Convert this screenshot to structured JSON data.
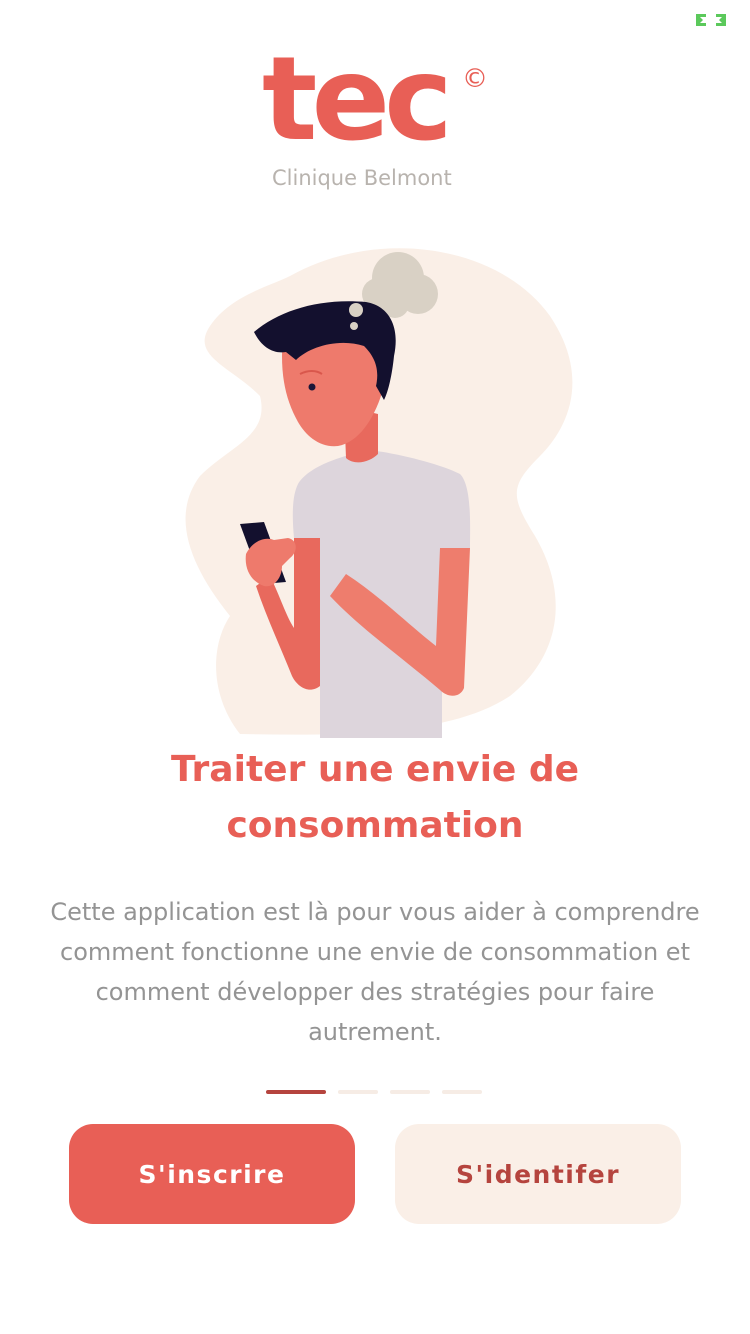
{
  "status_bar": {
    "icon": "expand-arrows-icon",
    "accent": "#5bc95b"
  },
  "logo": {
    "brand": "tec",
    "mark": "©",
    "subtitle": "Clinique Belmont"
  },
  "onboarding": {
    "title": "Traiter une envie de consommation",
    "description": "Cette application est là pour vous aider à comprendre comment fonctionne une envie de consommation et comment développer des stratégies pour faire autrement.",
    "pager": {
      "total": 4,
      "active_index": 0
    }
  },
  "actions": {
    "signup_label": "S'inscrire",
    "login_label": "S'identifer"
  },
  "colors": {
    "primary": "#e85f56",
    "primary_dark": "#b5443e",
    "secondary_bg": "#faefe7",
    "text_muted": "#949494",
    "logo_subtitle": "#b8b3ae"
  }
}
